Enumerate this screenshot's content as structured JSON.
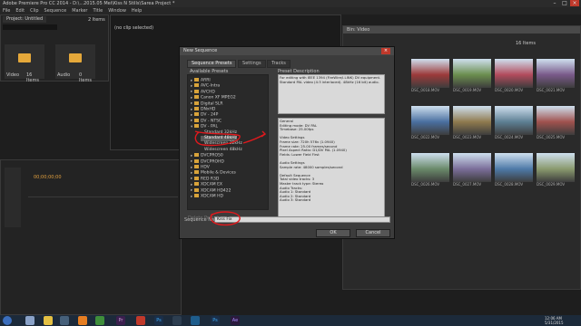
{
  "app": {
    "title": "Adobe Premiere Pro CC 2014 - D:\\...2015.05 Mei\\Kiss N Stills\\Sarea Project *",
    "menu": [
      "File",
      "Edit",
      "Clip",
      "Sequence",
      "Marker",
      "Title",
      "Window",
      "Help"
    ]
  },
  "project_panel": {
    "title": "Project: Untitled",
    "count": "2 Items",
    "search_placeholder": "",
    "bins": [
      {
        "name": "Video",
        "count": "16 Items"
      },
      {
        "name": "Audio",
        "count": "0 Items"
      }
    ]
  },
  "source_panel": {
    "label": "(no clip selected)"
  },
  "timeline_panel": {
    "timecode": "00;00;00;00"
  },
  "right_bin": {
    "title": "Bin: Video",
    "count": "16 Items",
    "thumbnails": [
      {
        "label": "DSC_0018.MOV"
      },
      {
        "label": "DSC_0019.MOV"
      },
      {
        "label": "DSC_0020.MOV"
      },
      {
        "label": "DSC_0021.MOV"
      },
      {
        "label": "DSC_0022.MOV"
      },
      {
        "label": "DSC_0023.MOV"
      },
      {
        "label": "DSC_0024.MOV"
      },
      {
        "label": "DSC_0025.MOV"
      },
      {
        "label": "DSC_0026.MOV"
      },
      {
        "label": "DSC_0027.MOV"
      },
      {
        "label": "DSC_0028.MOV"
      },
      {
        "label": "DSC_0029.MOV"
      }
    ]
  },
  "dialog": {
    "title": "New Sequence",
    "tabs": [
      "Sequence Presets",
      "Settings",
      "Tracks"
    ],
    "presets_header": "Available Presets",
    "description_header": "Preset Description",
    "tree": [
      {
        "label": "ARRI",
        "expanded": false
      },
      {
        "label": "AVC-Intra",
        "expanded": false
      },
      {
        "label": "AVCHD",
        "expanded": false
      },
      {
        "label": "Canon XF MPEG2",
        "expanded": false
      },
      {
        "label": "Digital SLR",
        "expanded": false
      },
      {
        "label": "DNxHD",
        "expanded": false
      },
      {
        "label": "DV - 24P",
        "expanded": false
      },
      {
        "label": "DV - NTSC",
        "expanded": false
      },
      {
        "label": "DV - PAL",
        "expanded": true
      },
      {
        "label": "Standard 32kHz",
        "expanded": false,
        "child": true
      },
      {
        "label": "Standard 48kHz",
        "expanded": false,
        "child": true,
        "selected": true
      },
      {
        "label": "Widescreen 32kHz",
        "expanded": false,
        "child": true
      },
      {
        "label": "Widescreen 48kHz",
        "expanded": false,
        "child": true
      },
      {
        "label": "DVCPRO50",
        "expanded": false
      },
      {
        "label": "DVCPROHD",
        "expanded": false
      },
      {
        "label": "HDV",
        "expanded": false
      },
      {
        "label": "Mobile & Devices",
        "expanded": false
      },
      {
        "label": "RED R3D",
        "expanded": false
      },
      {
        "label": "XDCAM EX",
        "expanded": false
      },
      {
        "label": "XDCAM HD422",
        "expanded": false
      },
      {
        "label": "XDCAM HD",
        "expanded": false
      }
    ],
    "description_top": "For editing with IEEE 1394 (FireWire/i.LINK) DV equipment. Standard PAL video (4:3 interlaced). 48kHz (16 bit) audio.",
    "description_bottom": [
      "General",
      "Editing mode: DV PAL",
      "Timebase: 25.00fps",
      "",
      "Video Settings",
      "Frame size: 720h 576v (1.0940)",
      "Frame rate: 25.00 frames/second",
      "Pixel Aspect Ratio: D1/DV PAL (1.0940)",
      "Fields: Lower Field First",
      "",
      "Audio Settings",
      "Sample rate: 48000 samples/second",
      "",
      "Default Sequence",
      "Total video tracks: 3",
      "Master track type: Stereo",
      "Audio Tracks:",
      "Audio 1: Standard",
      "Audio 2: Standard",
      "Audio 3: Standard"
    ],
    "delete_preset": "Delete Preset",
    "sequence_name_label": "Sequence Name:",
    "sequence_name_value": "Kiss Fix",
    "ok": "OK",
    "cancel": "Cancel"
  },
  "taskbar": {
    "time": "12:06 AM",
    "date": "5/31/2015"
  },
  "colors": {
    "accent_red": "#e0191d",
    "folder": "#e5a83a",
    "taskbar": "#1c2a3a"
  }
}
